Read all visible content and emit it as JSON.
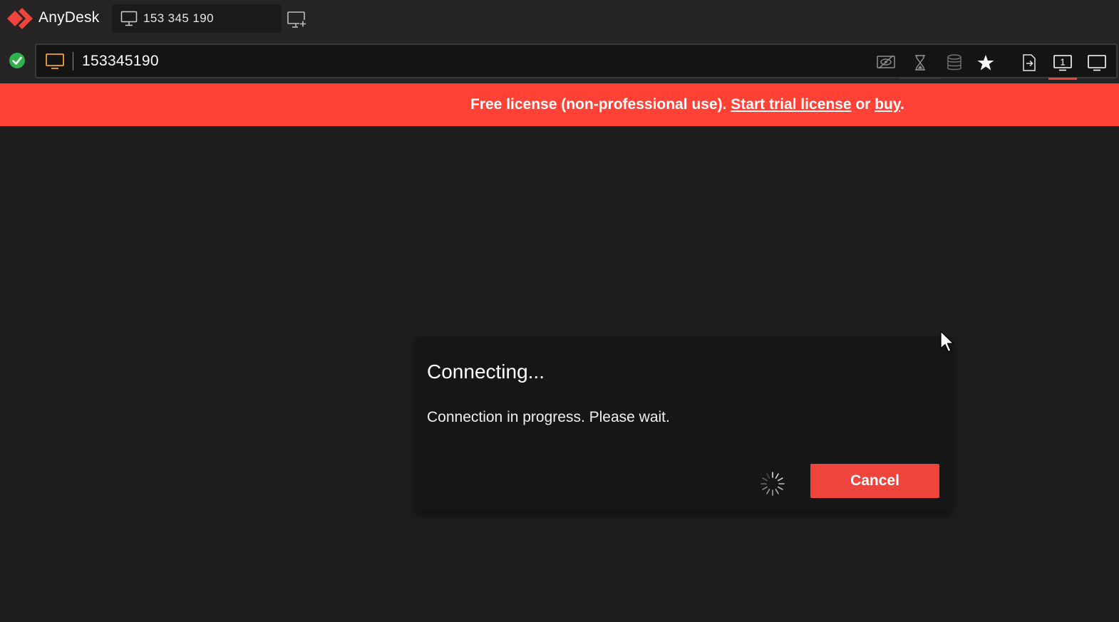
{
  "app": {
    "name": "AnyDesk",
    "brand_color": "#ef443b"
  },
  "tabs": [
    {
      "label": "153 345 190",
      "icon": "monitor-icon"
    }
  ],
  "toolbar": {
    "new_tab_icon": "new-session-icon",
    "status_icon": "connected-check-icon",
    "address": {
      "icon": "monitor-icon",
      "value": "153345190"
    },
    "tools": [
      {
        "name": "privacy-mode-icon"
      },
      {
        "name": "hourglass-icon"
      },
      {
        "name": "database-icon"
      },
      {
        "name": "favorite-star-icon"
      },
      {
        "name": "file-transfer-icon"
      },
      {
        "name": "monitor-1-icon",
        "label": "1"
      },
      {
        "name": "display-icon"
      }
    ]
  },
  "banner": {
    "prefix": "Free license (non-professional use). ",
    "trial_link": "Start trial license",
    "middle": " or ",
    "buy_link": "buy",
    "suffix": ".",
    "color": "#ff4136"
  },
  "dialog": {
    "title": "Connecting...",
    "message": "Connection in progress. Please wait.",
    "cancel_label": "Cancel"
  }
}
